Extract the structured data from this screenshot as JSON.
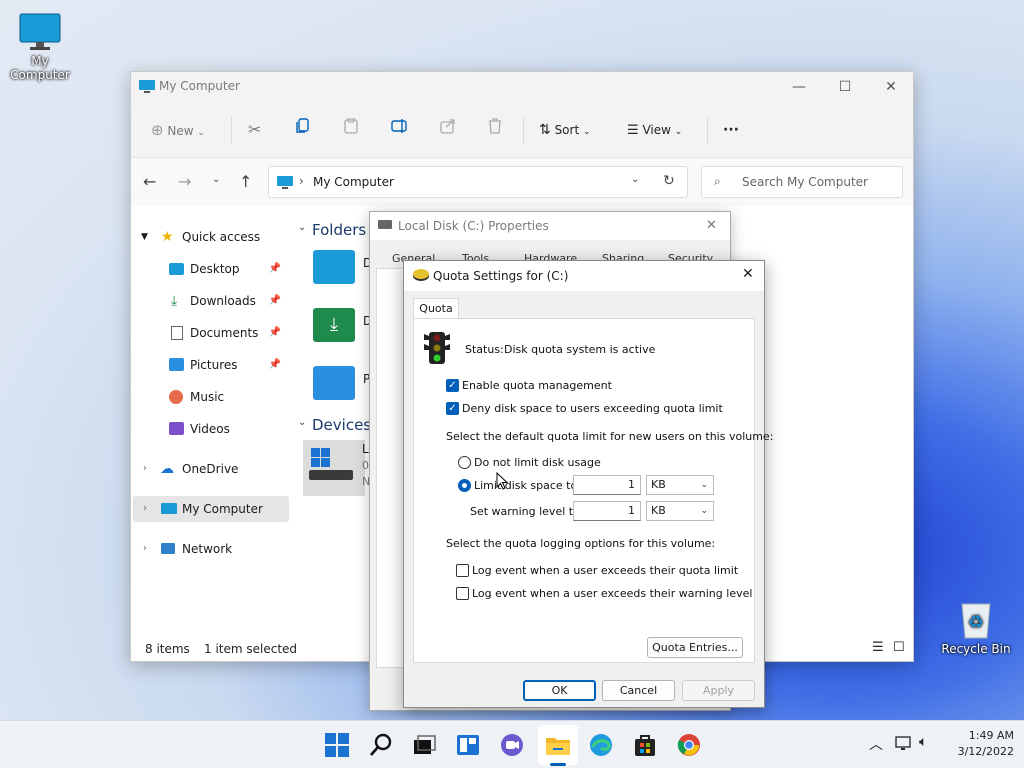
{
  "desktop": {
    "my_computer_label": "My Computer",
    "recycle_bin_label": "Recycle Bin"
  },
  "explorer": {
    "title": "My Computer",
    "toolbar": {
      "new_label": "New",
      "sort_label": "Sort",
      "view_label": "View",
      "more_label": "···"
    },
    "address": "My Computer",
    "search_placeholder": "Search My Computer",
    "sidebar": {
      "quick_access": "Quick access",
      "items": [
        {
          "label": "Desktop"
        },
        {
          "label": "Downloads"
        },
        {
          "label": "Documents"
        },
        {
          "label": "Pictures"
        },
        {
          "label": "Music"
        },
        {
          "label": "Videos"
        }
      ],
      "onedrive": "OneDrive",
      "my_computer": "My Computer",
      "network": "Network"
    },
    "content": {
      "folders_header": "Folders (",
      "devices_header": "Devices a",
      "folder_letters": [
        "D",
        "D",
        "P"
      ],
      "device_lines": [
        "Lo",
        "0",
        "N"
      ]
    },
    "status": {
      "items": "8 items",
      "selected": "1 item selected"
    }
  },
  "properties": {
    "title": "Local Disk (C:) Properties",
    "tabs": [
      "General",
      "Tools",
      "Hardware",
      "Sharing",
      "Security"
    ]
  },
  "quota": {
    "title": "Quota Settings for  (C:)",
    "tab": "Quota",
    "status_label": "Status:",
    "status_value": "Disk quota system is active",
    "enable": "Enable quota management",
    "deny": "Deny disk space to users exceeding quota limit",
    "default_limit_text": "Select the default quota limit for new users on this volume:",
    "no_limit": "Do not limit disk usage",
    "limit_to": "Limit disk space to",
    "limit_value": "1",
    "limit_unit": "KB",
    "warn_to": "Set warning level to",
    "warn_value": "1",
    "warn_unit": "KB",
    "logging_text": "Select the quota logging options for this volume:",
    "log_limit": "Log event when a user exceeds their quota limit",
    "log_warn": "Log event when a user exceeds their warning level",
    "entries_btn": "Quota Entries...",
    "ok": "OK",
    "cancel": "Cancel",
    "apply": "Apply"
  },
  "taskbar": {
    "time": "1:49 AM",
    "date": "3/12/2022"
  }
}
